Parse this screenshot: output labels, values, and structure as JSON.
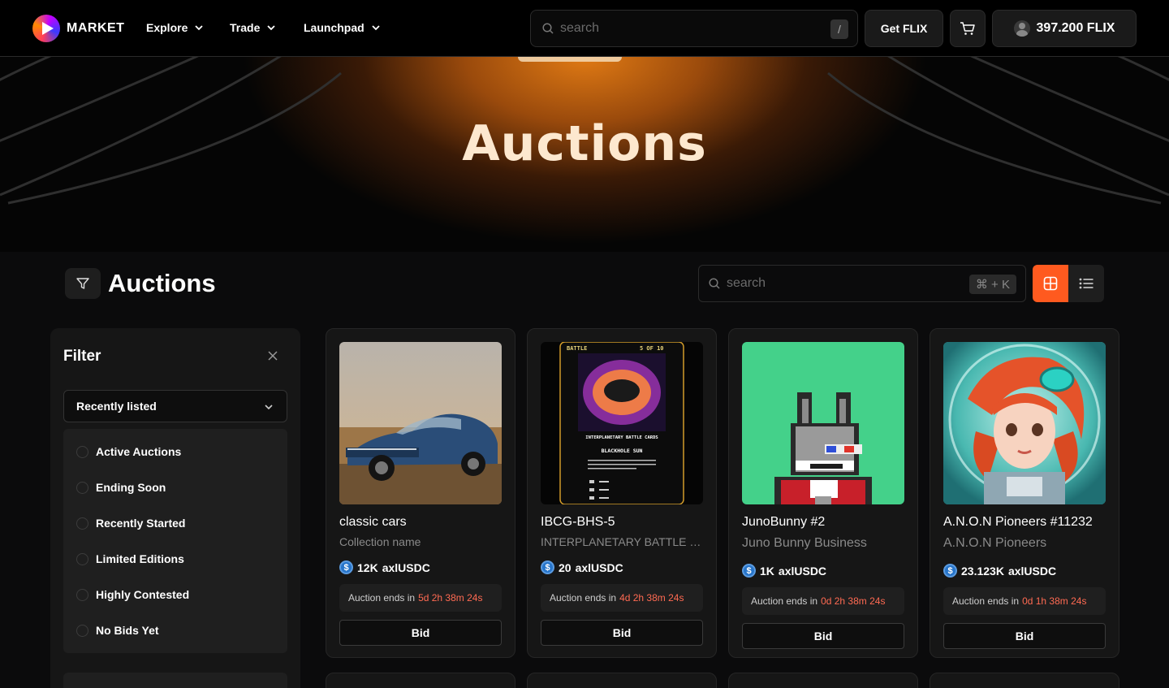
{
  "nav": {
    "brand": "MARKET",
    "links": [
      "Explore",
      "Trade",
      "Launchpad"
    ],
    "search_placeholder": "search",
    "search_shortcut": "/",
    "get_flix": "Get FLIX",
    "wallet_balance": "397.200 FLIX"
  },
  "hero": {
    "title": "Auctions"
  },
  "section": {
    "title": "Auctions",
    "search_placeholder": "search",
    "search_shortcut": "⌘ + K",
    "view_mode": "grid"
  },
  "filter": {
    "title": "Filter",
    "sort_selected": "Recently listed",
    "status_options": [
      "Active Auctions",
      "Ending Soon",
      "Recently Started",
      "Limited Editions",
      "Highly Contested",
      "No Bids Yet"
    ]
  },
  "cards": [
    {
      "title": "classic cars",
      "subtitle": "Collection name",
      "price": "12K",
      "currency": "axlUSDC",
      "timer_label": "Auction ends in",
      "timer": "5d 2h 38m 24s",
      "action": "Bid"
    },
    {
      "title": "IBCG-BHS-5",
      "subtitle": "INTERPLANETARY BATTLE CARDS",
      "price": "20",
      "currency": "axlUSDC",
      "timer_label": "Auction ends in",
      "timer": "4d 2h 38m 24s",
      "action": "Bid"
    },
    {
      "title": "JunoBunny #2",
      "subtitle": "Juno Bunny Business",
      "price": "1K",
      "currency": "axlUSDC",
      "timer_label": "Auction ends in",
      "timer": "0d 2h 38m 24s",
      "action": "Bid"
    },
    {
      "title": "A.N.O.N Pioneers #11232",
      "subtitle": "A.N.O.N Pioneers",
      "price": "23.123K",
      "currency": "axlUSDC",
      "timer_label": "Auction ends in",
      "timer": "0d 1h 38m 24s",
      "action": "Bid"
    }
  ],
  "battle_card": {
    "header_left": "BATTLE",
    "header_right": "5 OF 10",
    "banner": "INTERPLANETARY BATTLE CARDS",
    "name": "BLACKHOLE SUN"
  },
  "colors": {
    "accent": "#ff5a1f",
    "timer": "#ff6a52",
    "usdc": "#2775ca",
    "bunny_bg": "#44d18a"
  }
}
